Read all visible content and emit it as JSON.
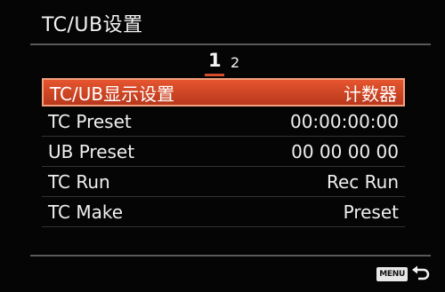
{
  "header": {
    "title": "TC/UB设置"
  },
  "pager": {
    "current": "1",
    "next": "2"
  },
  "menu": {
    "items": [
      {
        "label": "TC/UB显示设置",
        "value": "计数器"
      },
      {
        "label": "TC Preset",
        "value": "00:00:00:00"
      },
      {
        "label": "UB Preset",
        "value": "00 00 00 00"
      },
      {
        "label": "TC Run",
        "value": "Rec Run"
      },
      {
        "label": "TC Make",
        "value": "Preset"
      }
    ]
  },
  "footer": {
    "menu_label": "MENU",
    "return_icon": "return-arrow-icon"
  },
  "colors": {
    "selection": "#d64b2a",
    "text": "#f0f0f0",
    "background": "#050505"
  }
}
